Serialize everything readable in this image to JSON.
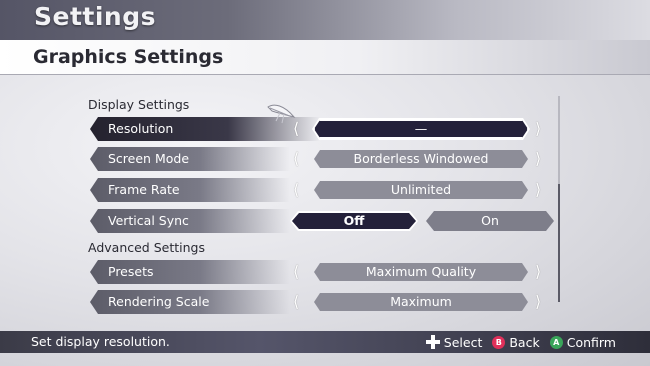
{
  "app": {
    "title": "Settings"
  },
  "page": {
    "title": "Graphics Settings"
  },
  "sections": {
    "display": "Display Settings",
    "advanced": "Advanced Settings"
  },
  "rows": [
    {
      "label": "Resolution",
      "value": "—"
    },
    {
      "label": "Screen Mode",
      "value": "Borderless Windowed"
    },
    {
      "label": "Frame Rate",
      "value": "Unlimited"
    },
    {
      "label": "Vertical Sync",
      "off": "Off",
      "on": "On"
    },
    {
      "label": "Presets",
      "value": "Maximum Quality"
    },
    {
      "label": "Rendering Scale",
      "value": "Maximum"
    }
  ],
  "footer": {
    "hint": "Set display resolution.",
    "select": "Select",
    "back": "Back",
    "confirm": "Confirm",
    "back_key": "B",
    "confirm_key": "A"
  },
  "colors": {
    "selected_value_bg": "#24213a",
    "back_button": "#e0305a",
    "confirm_button": "#3aa55a"
  }
}
